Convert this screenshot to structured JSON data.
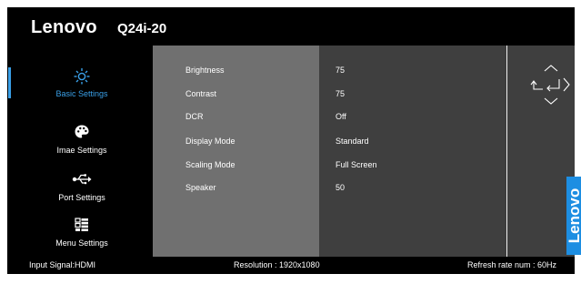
{
  "header": {
    "brand": "Lenovo",
    "model": "Q24i-20"
  },
  "sidebar": {
    "items": [
      {
        "label": "Basic Settings",
        "icon": "brightness-icon",
        "active": true
      },
      {
        "label": "Imae Settings",
        "icon": "palette-icon",
        "active": false
      },
      {
        "label": "Port Settings",
        "icon": "usb-icon",
        "active": false
      },
      {
        "label": "Menu Settings",
        "icon": "menu-grid-icon",
        "active": false
      }
    ]
  },
  "settings": {
    "rows": [
      {
        "label": "Brightness",
        "value": "75"
      },
      {
        "label": "Contrast",
        "value": "75"
      },
      {
        "label": "DCR",
        "value": "Off"
      },
      {
        "label": "Display  Mode",
        "value": "Standard"
      },
      {
        "label": "Scaling Mode",
        "value": "Full Screen"
      },
      {
        "label": "Speaker",
        "value": "50"
      }
    ]
  },
  "nav": {
    "icons": [
      "up-arrow-icon",
      "back-icon",
      "enter-icon",
      "right-arrow-icon",
      "down-arrow-icon"
    ]
  },
  "brand_strip": {
    "text": "Lenovo"
  },
  "footer": {
    "input_signal": "Input Signal:HDMI",
    "resolution": "Resolution  :  1920x1080",
    "refresh": "Refresh rate num  :  60Hz"
  },
  "colors": {
    "accent": "#3aa0e8",
    "brand_blue": "#1d8ee2",
    "panel_left": "#707070",
    "panel_right": "#3f3f3f",
    "background": "#000000"
  }
}
